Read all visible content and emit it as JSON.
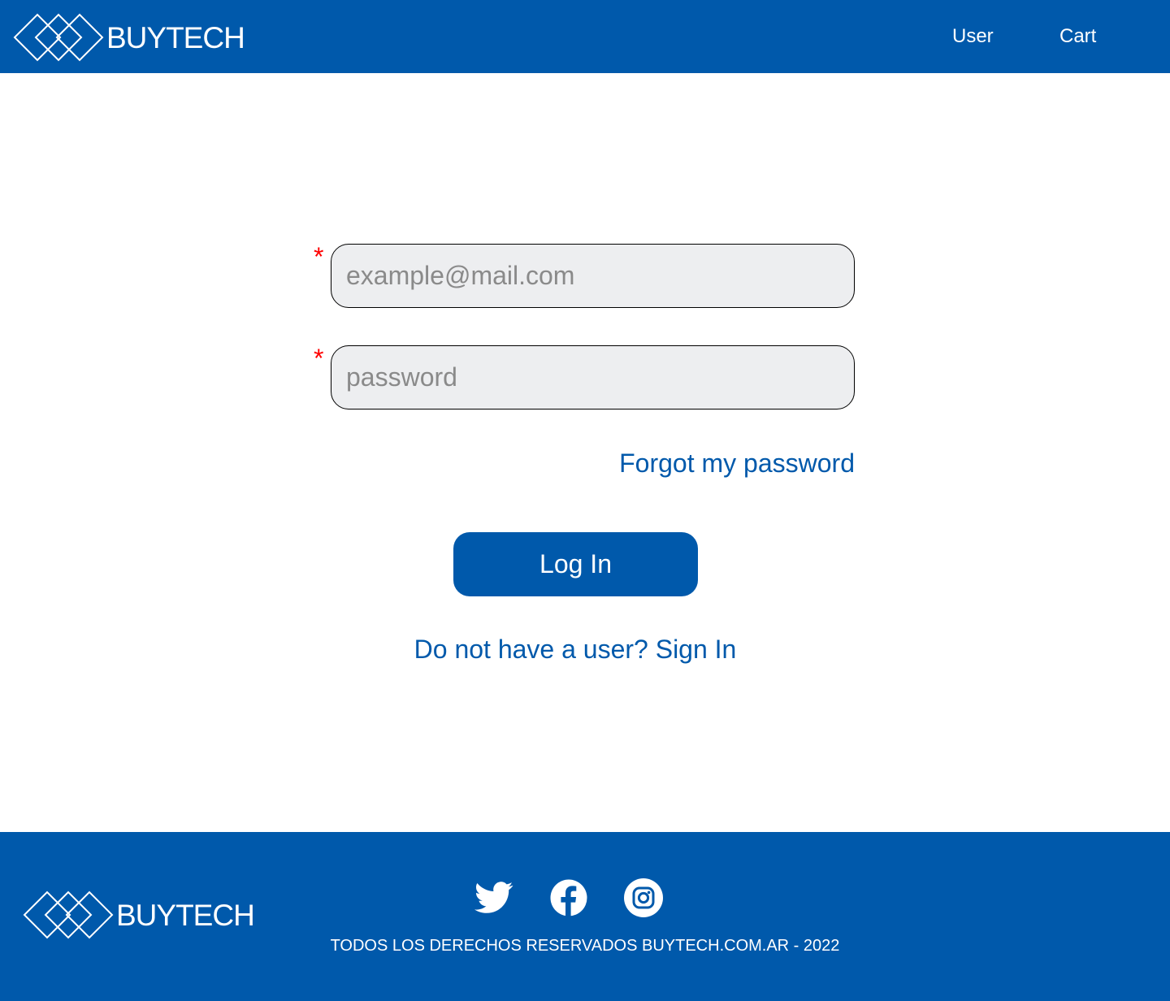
{
  "brand": {
    "name": "BUYTECH",
    "color": "#0059AB"
  },
  "header": {
    "nav": [
      {
        "label": "User",
        "icon": ""
      },
      {
        "label": "Cart",
        "icon": ""
      }
    ]
  },
  "form": {
    "email": {
      "placeholder": "example@mail.com",
      "value": "",
      "required_marker": "*"
    },
    "password": {
      "placeholder": "password",
      "value": "",
      "required_marker": "*"
    },
    "forgot_label": "Forgot my password",
    "login_label": "Log In",
    "signin_label": "Do not have a user? Sign In"
  },
  "footer": {
    "brand": "BUYTECH",
    "social_icons": [
      "twitter-icon",
      "facebook-icon",
      "instagram-icon"
    ],
    "copyright": "TODOS LOS DERECHOS RESERVADOS BUYTECH.COM.AR - 2022"
  },
  "colors": {
    "primary": "#0059AB",
    "input_background": "#EDEEF0",
    "required": "#FF0000"
  }
}
